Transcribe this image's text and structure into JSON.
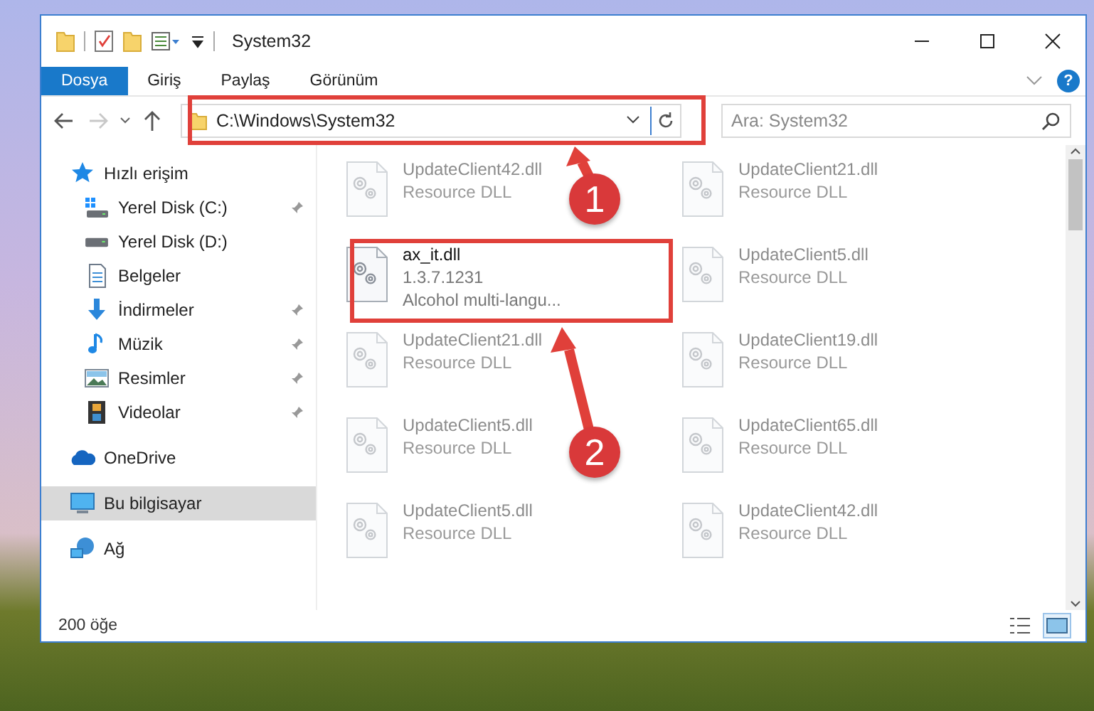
{
  "window": {
    "title": "System32"
  },
  "ribbon": {
    "tabs": [
      {
        "label": "Dosya",
        "kind": "file"
      },
      {
        "label": "Giriş",
        "kind": "tab"
      },
      {
        "label": "Paylaş",
        "kind": "tab"
      },
      {
        "label": "Görünüm",
        "kind": "tab"
      }
    ],
    "help": "?"
  },
  "navigation": {
    "forward_disabled": true
  },
  "address_bar": {
    "path": "C:\\Windows\\System32"
  },
  "search": {
    "placeholder": "Ara: System32"
  },
  "sidebar": {
    "items": [
      {
        "label": "Hızlı erişim",
        "kind": "star",
        "selected": false,
        "children": [
          {
            "label": "Yerel Disk (C:)",
            "kind": "drive-win",
            "pinned": true,
            "selected": false
          },
          {
            "label": "Yerel Disk (D:)",
            "kind": "drive",
            "selected": false
          },
          {
            "label": "Belgeler",
            "kind": "docs",
            "selected": false
          },
          {
            "label": "İndirmeler",
            "kind": "download",
            "pinned": true,
            "selected": false
          },
          {
            "label": "Müzik",
            "kind": "music",
            "pinned": true,
            "selected": false
          },
          {
            "label": "Resimler",
            "kind": "pictures",
            "pinned": true,
            "selected": false
          },
          {
            "label": "Videolar",
            "kind": "videos",
            "pinned": true,
            "selected": false
          }
        ]
      },
      {
        "label": "OneDrive",
        "kind": "cloud",
        "selected": false
      },
      {
        "label": "Bu bilgisayar",
        "kind": "computer",
        "selected": true
      },
      {
        "label": "Ağ",
        "kind": "network",
        "selected": false
      }
    ]
  },
  "files": [
    {
      "name": "UpdateClient42.dll",
      "lines": [
        "Resource DLL"
      ],
      "dimmed": true
    },
    {
      "name": "UpdateClient21.dll",
      "lines": [
        "Resource DLL"
      ],
      "dimmed": true
    },
    {
      "name": "ax_it.dll",
      "lines": [
        "1.3.7.1231",
        "Alcohol multi-langu..."
      ],
      "dimmed": false
    },
    {
      "name": "UpdateClient5.dll",
      "lines": [
        "Resource DLL"
      ],
      "dimmed": true
    },
    {
      "name": "UpdateClient21.dll",
      "lines": [
        "Resource DLL"
      ],
      "dimmed": true
    },
    {
      "name": "UpdateClient19.dll",
      "lines": [
        "Resource DLL"
      ],
      "dimmed": true
    },
    {
      "name": "UpdateClient5.dll",
      "lines": [
        "Resource DLL"
      ],
      "dimmed": true
    },
    {
      "name": "UpdateClient65.dll",
      "lines": [
        "Resource DLL"
      ],
      "dimmed": true
    },
    {
      "name": "UpdateClient5.dll",
      "lines": [
        "Resource DLL"
      ],
      "dimmed": true
    },
    {
      "name": "UpdateClient42.dll",
      "lines": [
        "Resource DLL"
      ],
      "dimmed": true
    }
  ],
  "status_bar": {
    "count": "200 öğe",
    "views": [
      {
        "kind": "details",
        "selected": false
      },
      {
        "kind": "large-icons",
        "selected": true
      }
    ]
  },
  "annotations": [
    {
      "label": "1"
    },
    {
      "label": "2"
    }
  ]
}
